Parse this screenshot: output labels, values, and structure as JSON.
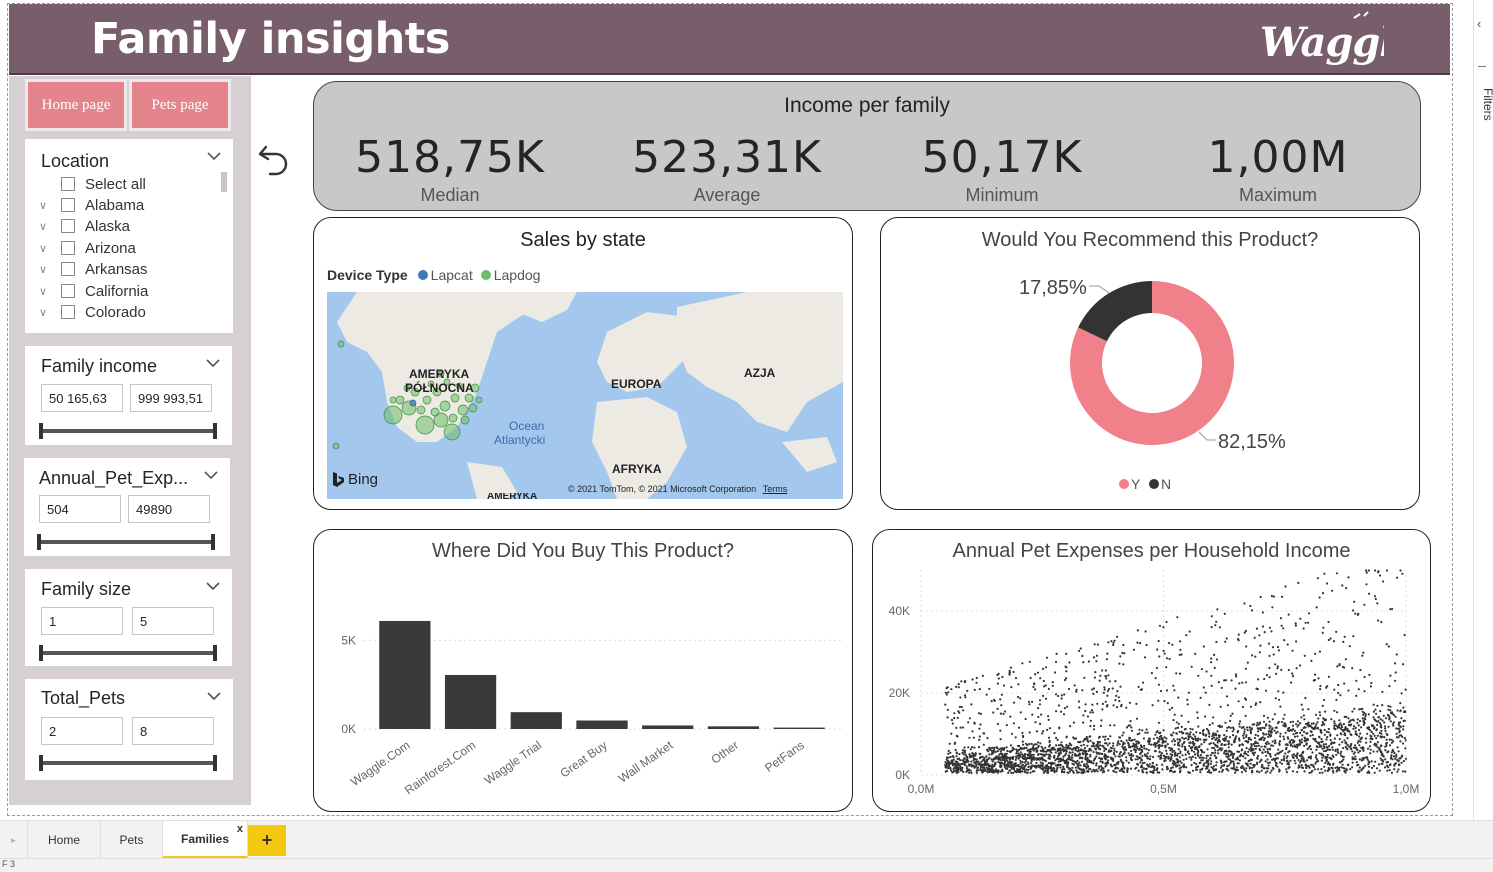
{
  "header": {
    "title": "Family insights",
    "logo_text": "Waggle",
    "bg_color": "#785d6b"
  },
  "nav": {
    "home_label": "Home page",
    "pets_label": "Pets page",
    "btn_color": "#e4858e"
  },
  "slicers": {
    "location": {
      "title": "Location",
      "items": [
        "Select all",
        "Alabama",
        "Alaska",
        "Arizona",
        "Arkansas",
        "California",
        "Colorado"
      ]
    },
    "family_income": {
      "title": "Family income",
      "min": "50 165,63",
      "max": "999 993,51"
    },
    "annual_pet_exp": {
      "title": "Annual_Pet_Exp...",
      "min": "504",
      "max": "49890"
    },
    "family_size": {
      "title": "Family size",
      "min": "1",
      "max": "5"
    },
    "total_pets": {
      "title": "Total_Pets",
      "min": "2",
      "max": "8"
    }
  },
  "kpi": {
    "title": "Income per family",
    "items": [
      {
        "value": "518,75K",
        "label": "Median"
      },
      {
        "value": "523,31K",
        "label": "Average"
      },
      {
        "value": "50,17K",
        "label": "Minimum"
      },
      {
        "value": "1,00M",
        "label": "Maximum"
      }
    ]
  },
  "map": {
    "title": "Sales by state",
    "legend_title": "Device Type",
    "legend_items": [
      {
        "name": "Lapcat",
        "color": "#3c7ab8"
      },
      {
        "name": "Lapdog",
        "color": "#6dbd6a"
      }
    ],
    "labels": {
      "north_america": "AMERYKA",
      "north_america2": "PÓŁNOCNA",
      "europe": "EUROPA",
      "asia": "AZJA",
      "ocean": "Ocean",
      "ocean2": "Atlantycki",
      "africa": "AFRYKA",
      "south_america": "AMERYKA"
    },
    "bing": "Bing",
    "copyright": "© 2021 TomTom, © 2021 Microsoft Corporation",
    "terms": "Terms"
  },
  "tabs": {
    "home": "Home",
    "pets": "Pets",
    "families": "Families",
    "add": "+",
    "close": "x"
  },
  "filters_label": "Filters",
  "status_text": "F 3",
  "chart_data": [
    {
      "type": "pie",
      "title": "Would You Recommend this Product?",
      "labels": [
        "Y",
        "N"
      ],
      "values": [
        82.15,
        17.85
      ],
      "value_labels": [
        "82,15%",
        "17,85%"
      ],
      "colors": [
        "#f08089",
        "#333333"
      ],
      "legend": "bottom"
    },
    {
      "type": "bar",
      "title": "Where Did You Buy This Product?",
      "categories": [
        "Waggle.Com",
        "Rainforest.Com",
        "Waggle Trial",
        "Great Buy",
        "Wall Market",
        "Other",
        "PetFans"
      ],
      "values": [
        6100,
        3050,
        950,
        480,
        200,
        150,
        80
      ],
      "ytick_labels": [
        "0K",
        "5K"
      ],
      "ytick_values": [
        0,
        5000
      ],
      "ylim": [
        0,
        7000
      ],
      "grid": true,
      "color": "#3a3a3a"
    },
    {
      "type": "scatter",
      "title": "Annual Pet Expenses per Household Income",
      "xtick_labels": [
        "0,0M",
        "0,5M",
        "1,0M"
      ],
      "xtick_values": [
        0,
        500000,
        1000000
      ],
      "ytick_labels": [
        "0K",
        "20K",
        "40K"
      ],
      "ytick_values": [
        0,
        20000,
        40000
      ],
      "xlim": [
        0,
        1000000
      ],
      "ylim": [
        0,
        50000
      ],
      "grid": true,
      "color": "#333333"
    }
  ]
}
